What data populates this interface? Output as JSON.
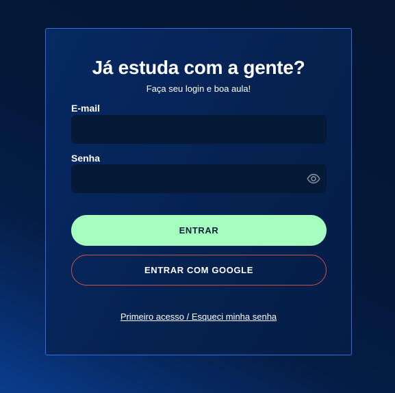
{
  "login": {
    "title": "Já estuda com a gente?",
    "subtitle": "Faça seu login e boa aula!",
    "email_label": "E-mail",
    "email_value": "",
    "password_label": "Senha",
    "password_value": "",
    "submit_label": "ENTRAR",
    "google_label": "ENTRAR COM GOOGLE",
    "forgot_link": "Primeiro acesso / Esqueci minha senha"
  },
  "icons": {
    "password_toggle": "eye-icon"
  },
  "colors": {
    "background": "#041633",
    "card_border": "#2f6fe0",
    "primary_button": "#a6fdc0",
    "google_button_border": "#c4524f",
    "input_background": "#041a36"
  }
}
